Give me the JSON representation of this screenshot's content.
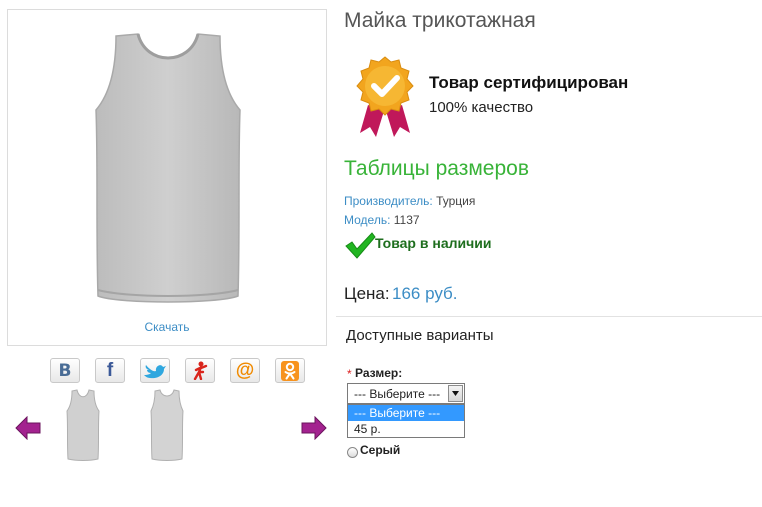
{
  "product": {
    "title": "Майка трикотажная",
    "download_label": "Скачать"
  },
  "certificate": {
    "title": "Товар сертифицирован",
    "subtitle": "100% качество",
    "badge_icon": "certificate-ribbon-icon"
  },
  "size_table_link": "Таблицы размеров",
  "info": {
    "manufacturer_label": "Производитель:",
    "manufacturer_value": "Турция",
    "model_label": "Модель:",
    "model_value": "1137"
  },
  "stock": {
    "text": "Товар в наличии",
    "icon": "check-icon"
  },
  "price": {
    "label": "Цена:",
    "value": "166 руб."
  },
  "variants": {
    "title": "Доступные варианты",
    "required_marker": "*",
    "size_label": "Размер:",
    "selected": "--- Выберите ---",
    "options": [
      "--- Выберите ---",
      "45 р."
    ],
    "color_option": "Серый"
  },
  "social": [
    {
      "name": "vk-icon",
      "glyph": "В",
      "color": "#4a6d96"
    },
    {
      "name": "facebook-icon",
      "glyph": "f",
      "color": "#3b5998"
    },
    {
      "name": "twitter-icon",
      "glyph": "",
      "color": "#2fa7df"
    },
    {
      "name": "moimir-icon",
      "glyph": "",
      "color": "#d9241b"
    },
    {
      "name": "mailru-icon",
      "glyph": "@",
      "color": "#f08a00"
    },
    {
      "name": "odnoklassniki-icon",
      "glyph": "",
      "color": "#f7931e"
    }
  ],
  "colors": {
    "accent_blue": "#3c8dc5",
    "accent_green": "#38b338",
    "arrow_purple": "#a3228f",
    "shirt_gray": "#c8c8c8"
  }
}
